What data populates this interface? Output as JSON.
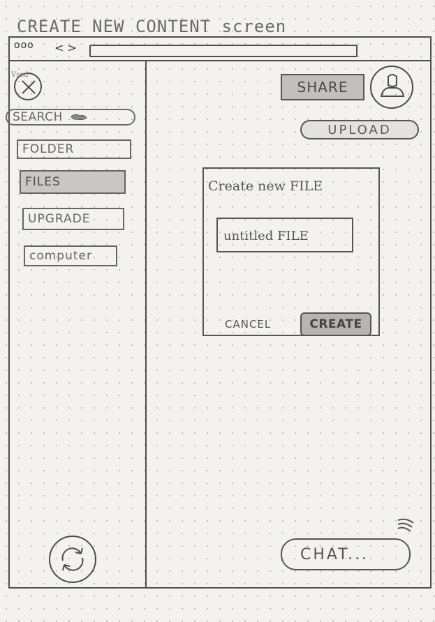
{
  "screen_title": "CREATE NEW CONTENT screen",
  "browser": {
    "window_controls": "ooo",
    "nav_arrows": "< >",
    "address_value": ""
  },
  "sidebar": {
    "logo_scribble": "Vsed",
    "search_label": "SEARCH",
    "items": [
      {
        "label": "FOLDER",
        "selected": false
      },
      {
        "label": "FILES",
        "selected": true
      },
      {
        "label": "UPGRADE",
        "selected": false
      },
      {
        "label": "computer",
        "selected": false
      }
    ]
  },
  "header": {
    "share_label": "SHARE",
    "upload_label": "UPLOAD"
  },
  "dialog": {
    "title": "Create new FILE",
    "filename_value": "untitled FILE",
    "cancel_label": "CANCEL",
    "create_label": "CREATE"
  },
  "chat": {
    "label": "CHAT..."
  },
  "icons": [
    "logo-x-icon",
    "search-icon",
    "avatar-person-icon",
    "sync-icon",
    "chat-signal-icon"
  ],
  "colors": {
    "paper": "#f3f2ef",
    "pencil": "#555555",
    "shaded": "#c2c0bc"
  }
}
